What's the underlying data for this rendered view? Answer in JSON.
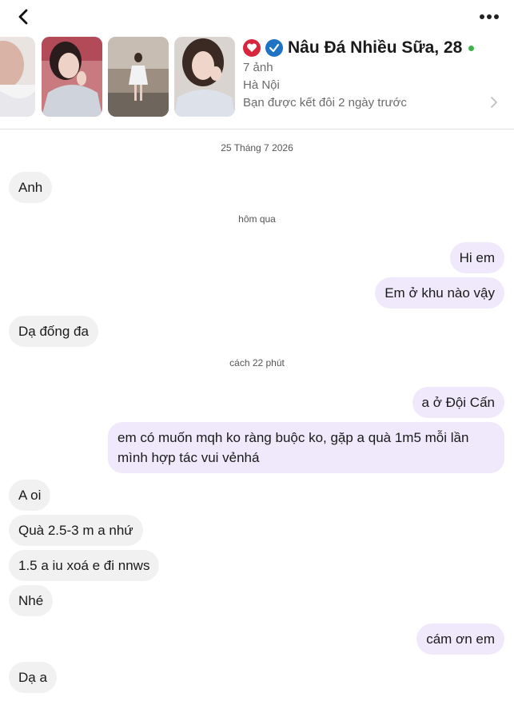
{
  "icons": {
    "back": "chevron-left-icon",
    "more": "more-dots-icon",
    "chevron": "chevron-right-icon",
    "match_badge": "heart-badge-icon",
    "verified": "verified-check-icon"
  },
  "colors": {
    "incoming_bubble": "#f1f1f1",
    "outgoing_bubble": "#efe9fb",
    "online_dot": "#3db24b",
    "verified": "#1f73c4",
    "badge": "#d7263d"
  },
  "profile": {
    "name": "Nâu Đá Nhiều Sữa, 28",
    "photos_count": "7 ảnh",
    "location": "Hà Nội",
    "matched": "Bạn được kết đôi 2 ngày trước"
  },
  "dates": {
    "d1": "25 Tháng 7 2026",
    "d2": "hôm qua",
    "d3": "cách 22 phút"
  },
  "messages": [
    {
      "from": "them",
      "text": "Anh"
    },
    {
      "from": "me",
      "text": "Hi em"
    },
    {
      "from": "me",
      "text": "Em ở khu nào vậy"
    },
    {
      "from": "them",
      "text": "Dạ đống đa"
    },
    {
      "from": "me",
      "text": "a ở Đội Cấn"
    },
    {
      "from": "me",
      "text": "em có muốn mqh ko ràng buộc ko, gặp a quà 1m5 mỗi lần mình hợp tác vui vẻnhá"
    },
    {
      "from": "them",
      "text": "A oi"
    },
    {
      "from": "them",
      "text": "Quà 2.5-3 m a nhứ"
    },
    {
      "from": "them",
      "text": "1.5 a iu xoá e đi nnws"
    },
    {
      "from": "them",
      "text": "Nhé"
    },
    {
      "from": "me",
      "text": "cám ơn em"
    },
    {
      "from": "them",
      "text": "Dạ a"
    }
  ]
}
